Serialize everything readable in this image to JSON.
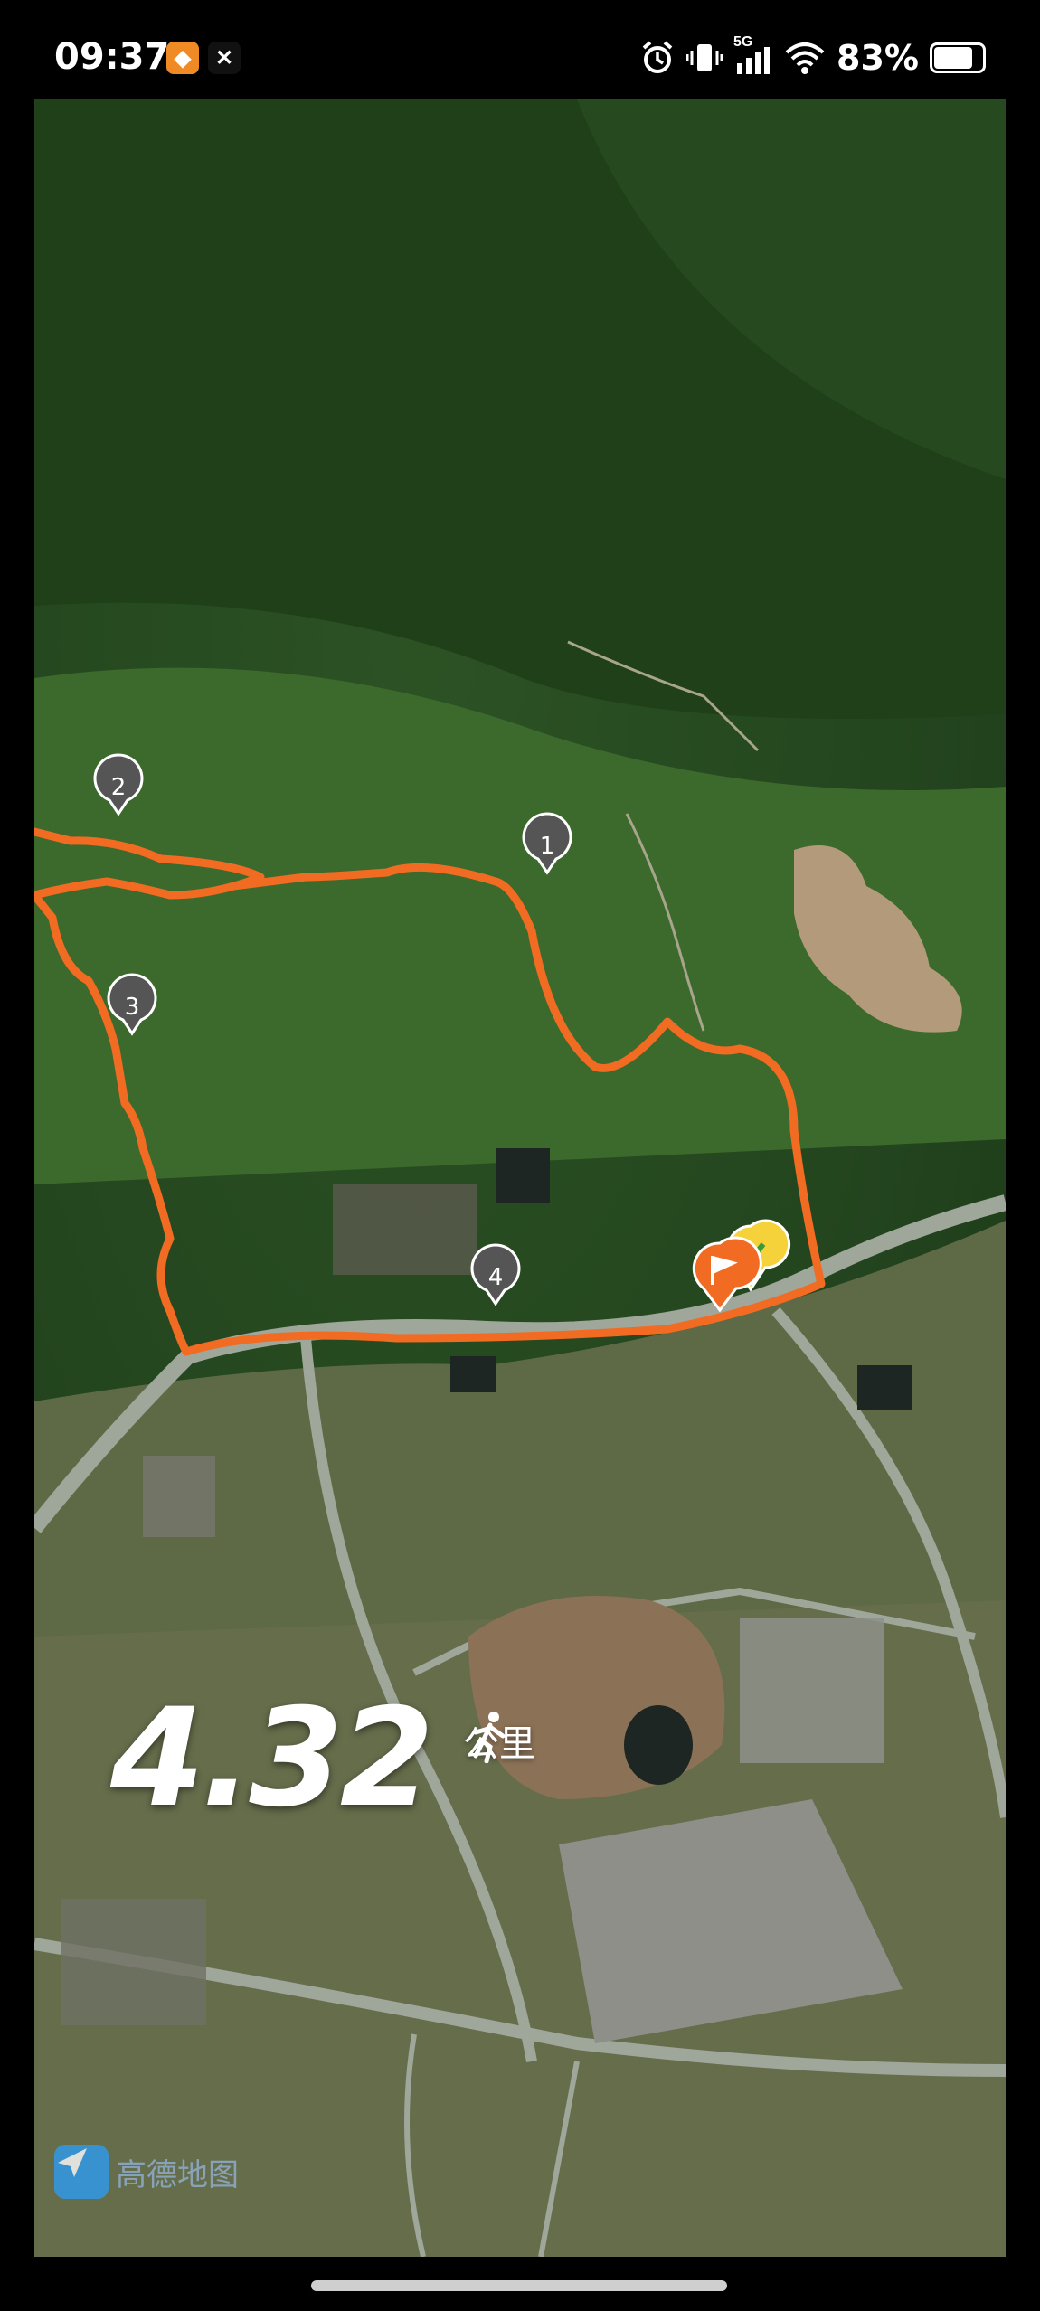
{
  "status_bar": {
    "time": "09:37",
    "network": "5G",
    "battery_percent": "83%",
    "battery_level": 0.83,
    "icons": [
      "app-badge-icon",
      "app-badge-icon",
      "alarm-icon",
      "vibrate-icon",
      "signal-icon",
      "wifi-icon",
      "battery-icon"
    ]
  },
  "map": {
    "waypoints": [
      "1",
      "2",
      "3",
      "4"
    ],
    "route_color": "#f26b22",
    "start_marker_icon": "flag-pin-icon",
    "end_marker_icon": "check-pin-icon"
  },
  "overlay": {
    "distance": "4.32",
    "unit": "公里",
    "activity_icon": "walking-person-icon"
  },
  "watermark": {
    "text": "高德地图",
    "icon": "amap-logo-icon"
  }
}
